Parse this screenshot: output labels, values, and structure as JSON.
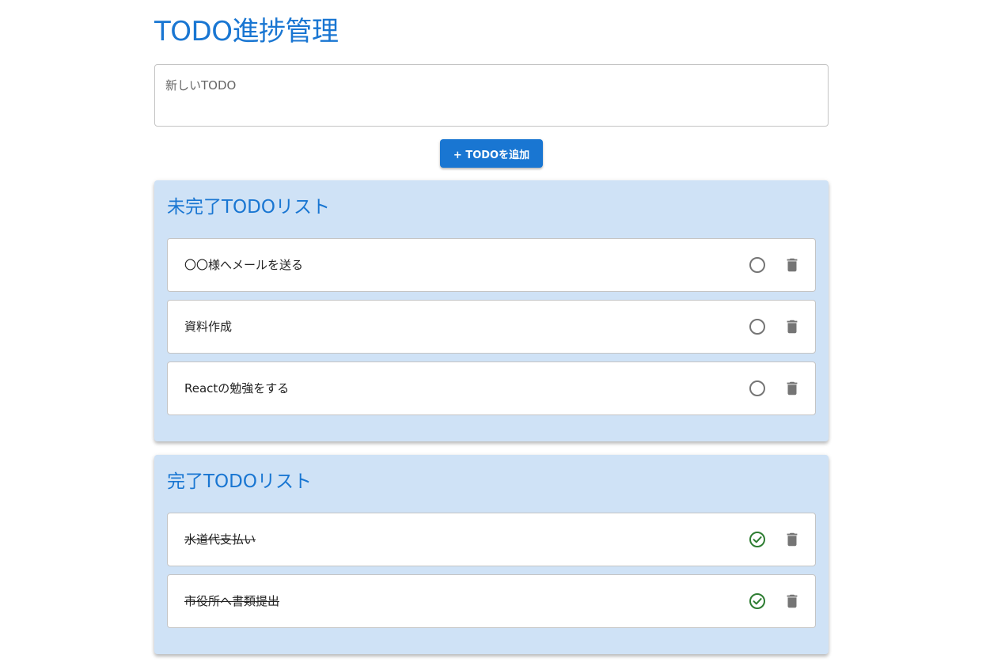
{
  "header": {
    "title": "TODO進捗管理"
  },
  "new_todo": {
    "placeholder": "新しいTODO",
    "value": ""
  },
  "add_button": {
    "label": "+ TODOを追加"
  },
  "incomplete": {
    "title": "未完了TODOリスト",
    "items": [
      {
        "text": "〇〇様へメールを送る"
      },
      {
        "text": "資料作成"
      },
      {
        "text": "Reactの勉強をする"
      }
    ],
    "status_icon": "unchecked-circle-icon",
    "delete_icon": "trash-icon"
  },
  "complete": {
    "title": "完了TODOリスト",
    "items": [
      {
        "text": "水道代支払い"
      },
      {
        "text": "市役所へ書類提出"
      }
    ],
    "status_icon": "check-circle-icon",
    "delete_icon": "trash-icon"
  },
  "colors": {
    "primary": "#1976d2",
    "section_background": "#cfe2f6",
    "done_check": "#2e7d32",
    "icon_gray": "#757575"
  }
}
